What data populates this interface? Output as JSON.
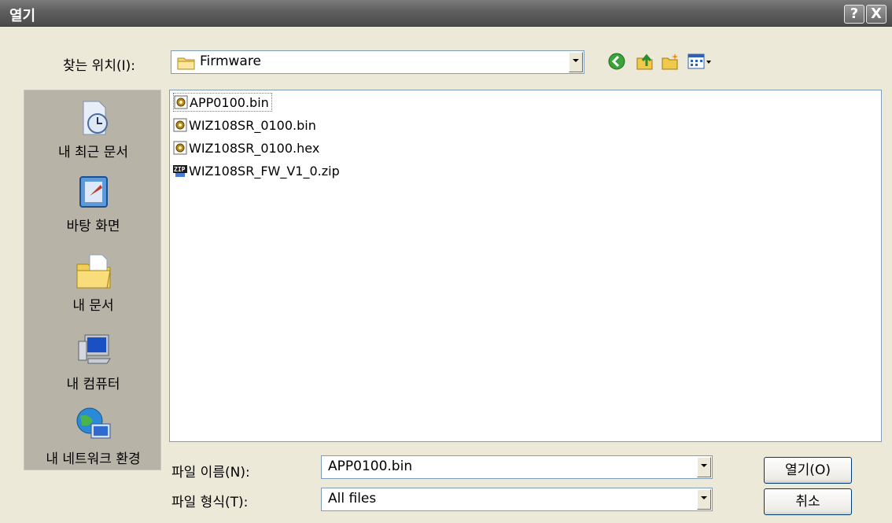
{
  "window": {
    "title": "열기",
    "help_glyph": "?",
    "close_glyph": "X"
  },
  "look_in": {
    "label": "찾는 위치(I):",
    "value": "Firmware"
  },
  "toolbar_icons": [
    "back-icon",
    "up-folder-icon",
    "new-folder-icon",
    "view-menu-icon"
  ],
  "places": [
    {
      "label": "내 최근 문서",
      "icon": "recent-documents-icon"
    },
    {
      "label": "바탕 화면",
      "icon": "desktop-icon"
    },
    {
      "label": "내 문서",
      "icon": "my-documents-icon"
    },
    {
      "label": "내 컴퓨터",
      "icon": "my-computer-icon"
    },
    {
      "label": "내 네트워크 환경",
      "icon": "network-places-icon"
    }
  ],
  "files": [
    {
      "name": "APP0100.bin",
      "icon": "bin-file-icon",
      "selected": true
    },
    {
      "name": "WIZ108SR_0100.bin",
      "icon": "bin-file-icon",
      "selected": false
    },
    {
      "name": "WIZ108SR_0100.hex",
      "icon": "hex-file-icon",
      "selected": false
    },
    {
      "name": "WIZ108SR_FW_V1_0.zip",
      "icon": "zip-file-icon",
      "selected": false
    }
  ],
  "filename": {
    "label": "파일 이름(N):",
    "value": "APP0100.bin"
  },
  "filetype": {
    "label": "파일 형식(T):",
    "value": "All files"
  },
  "buttons": {
    "open": "열기(O)",
    "cancel": "취소"
  },
  "colors": {
    "title_bar": "#5e5e5e",
    "dialog_bg": "#ece9d8",
    "places_bg": "#b7b4a7",
    "input_border": "#7f9db9",
    "button_border": "#003c74"
  }
}
